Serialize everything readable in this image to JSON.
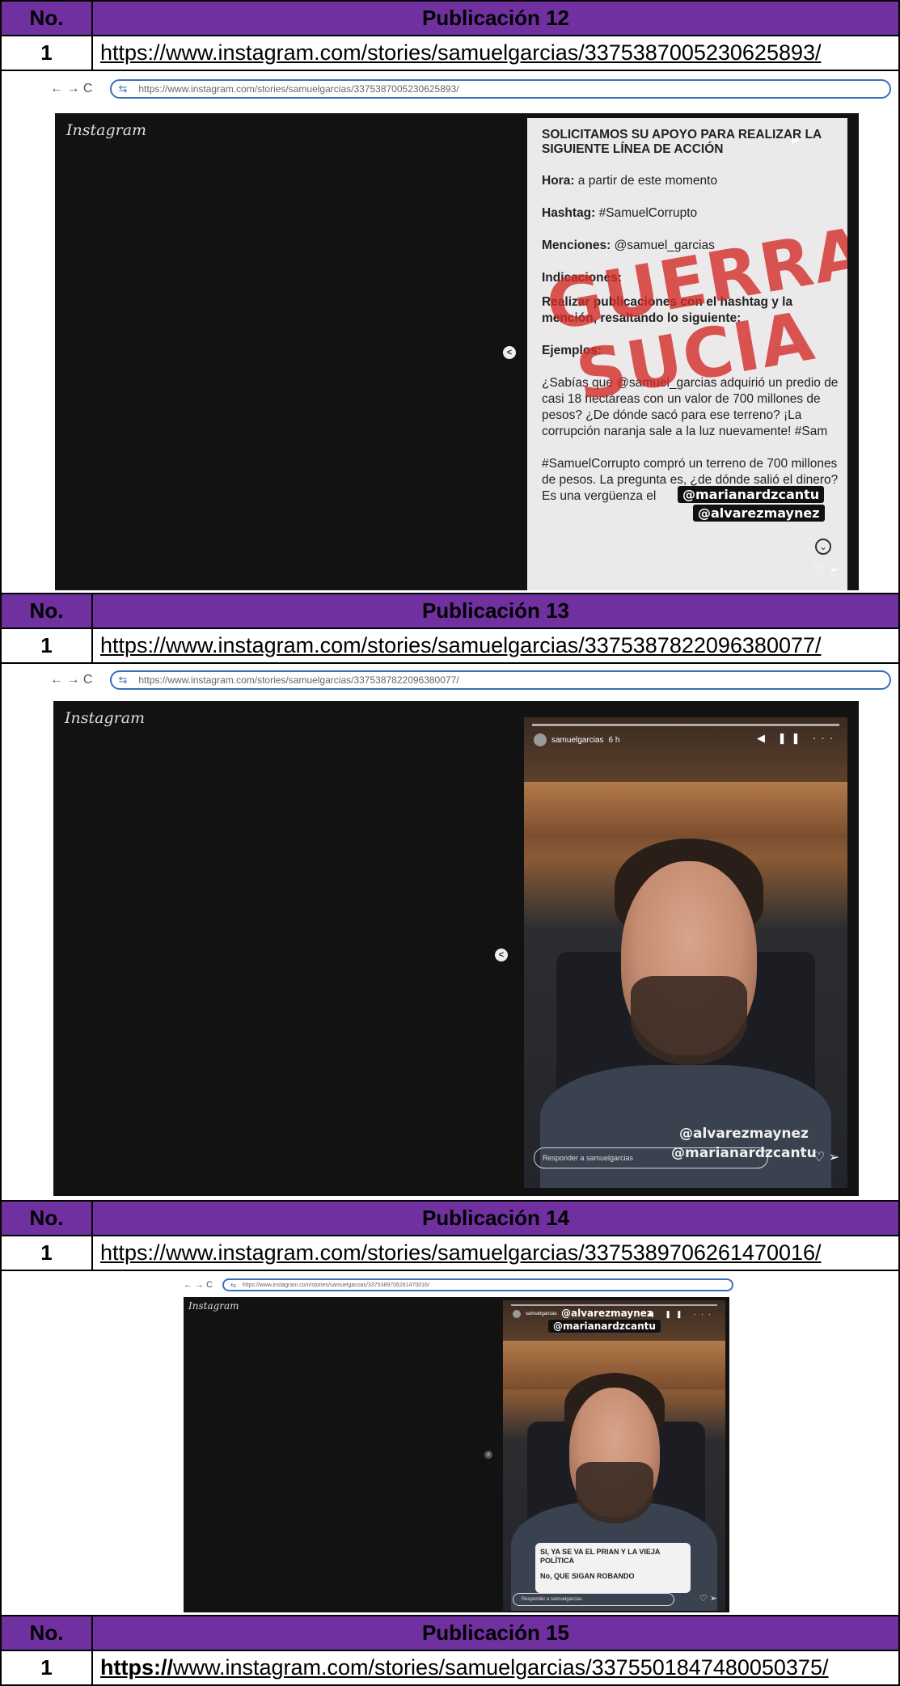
{
  "headers": {
    "no_label": "No."
  },
  "publications": [
    {
      "title": "Publicación 12",
      "number": "1",
      "url": "https://www.instagram.com/stories/samuelgarcias/3375387005230625893/"
    },
    {
      "title": "Publicación 13",
      "number": "1",
      "url": "https://www.instagram.com/stories/samuelgarcias/3375387822096380077/"
    },
    {
      "title": "Publicación 14",
      "number": "1",
      "url": "https://www.instagram.com/stories/samuelgarcias/3375389706261470016/"
    },
    {
      "title": "Publicación 15",
      "number": "1",
      "url_prefix": "https://",
      "url_rest": "www.instagram.com/stories/samuelgarcias/3375501847480050375/"
    }
  ],
  "browser": {
    "nav": "←   →   C",
    "tune_icon": "⇆",
    "addresses": [
      "https://www.instagram.com/stories/samuelgarcias/3375387005230625893/",
      "https://www.instagram.com/stories/samuelgarcias/3375387822096380077/",
      "https://www.instagram.com/stories/samuelgarcias/3375389706261470016/"
    ]
  },
  "instagram": {
    "logo": "Instagram",
    "prev_glyph": "<"
  },
  "story12": {
    "heading": "SOLICITAMOS SU APOYO PARA REALIZAR LA SIGUIENTE LÍNEA DE ACCIÓN",
    "hora_label": "Hora:",
    "hora_value": " a partir de este momento",
    "hashtag_label": "Hashtag:",
    "hashtag_value": " #SamuelCorrupto",
    "menciones_label": "Menciones:",
    "menciones_value": " @samuel_garcias",
    "indicaciones_label": "Indicaciones:",
    "indicaciones_text": "Realizar publicaciones con el hashtag y la mención, resaltando lo siguiente:",
    "ejemplos_label": "Ejemplos:",
    "ejemplo1": "¿Sabías que @samuel_garcias adquirió un predio de casi 18 hectáreas con un valor de 700 millones de pesos? ¿De dónde sacó para ese terreno? ¡La corrupción naranja sale a la luz nuevamente! #Sam",
    "ejemplo2": "#SamuelCorrupto compró un terreno de 700 millones de pesos. La pregunta es, ¿de dónde salió el dinero? Es una vergüenza el",
    "stamp1": "GUERRA",
    "stamp2": "SUCIA",
    "tag1": "@marianardzcantu",
    "tag2": "@alvarezmaynez",
    "controls": "▶ ···"
  },
  "story13": {
    "user": "samuelgarcias",
    "time": "6 h",
    "controls": "◀ ❚❚ ···",
    "tag1": "@alvarezmaynez",
    "tag2": "@marianardzcantu",
    "reply": "Responder a samuelgarcias"
  },
  "story14": {
    "user": "samuelgarcias",
    "controls": "◀ ❚❚ ···",
    "tag1": "@alvarezmaynez",
    "tag2": "@marianardzcantu",
    "poll_option1": "SI, YA SE VA EL PRIAN Y LA VIEJA POLÍTICA",
    "poll_option2": "No, QUE SIGAN ROBANDO",
    "reply": "Responder a samuelgarcias"
  }
}
